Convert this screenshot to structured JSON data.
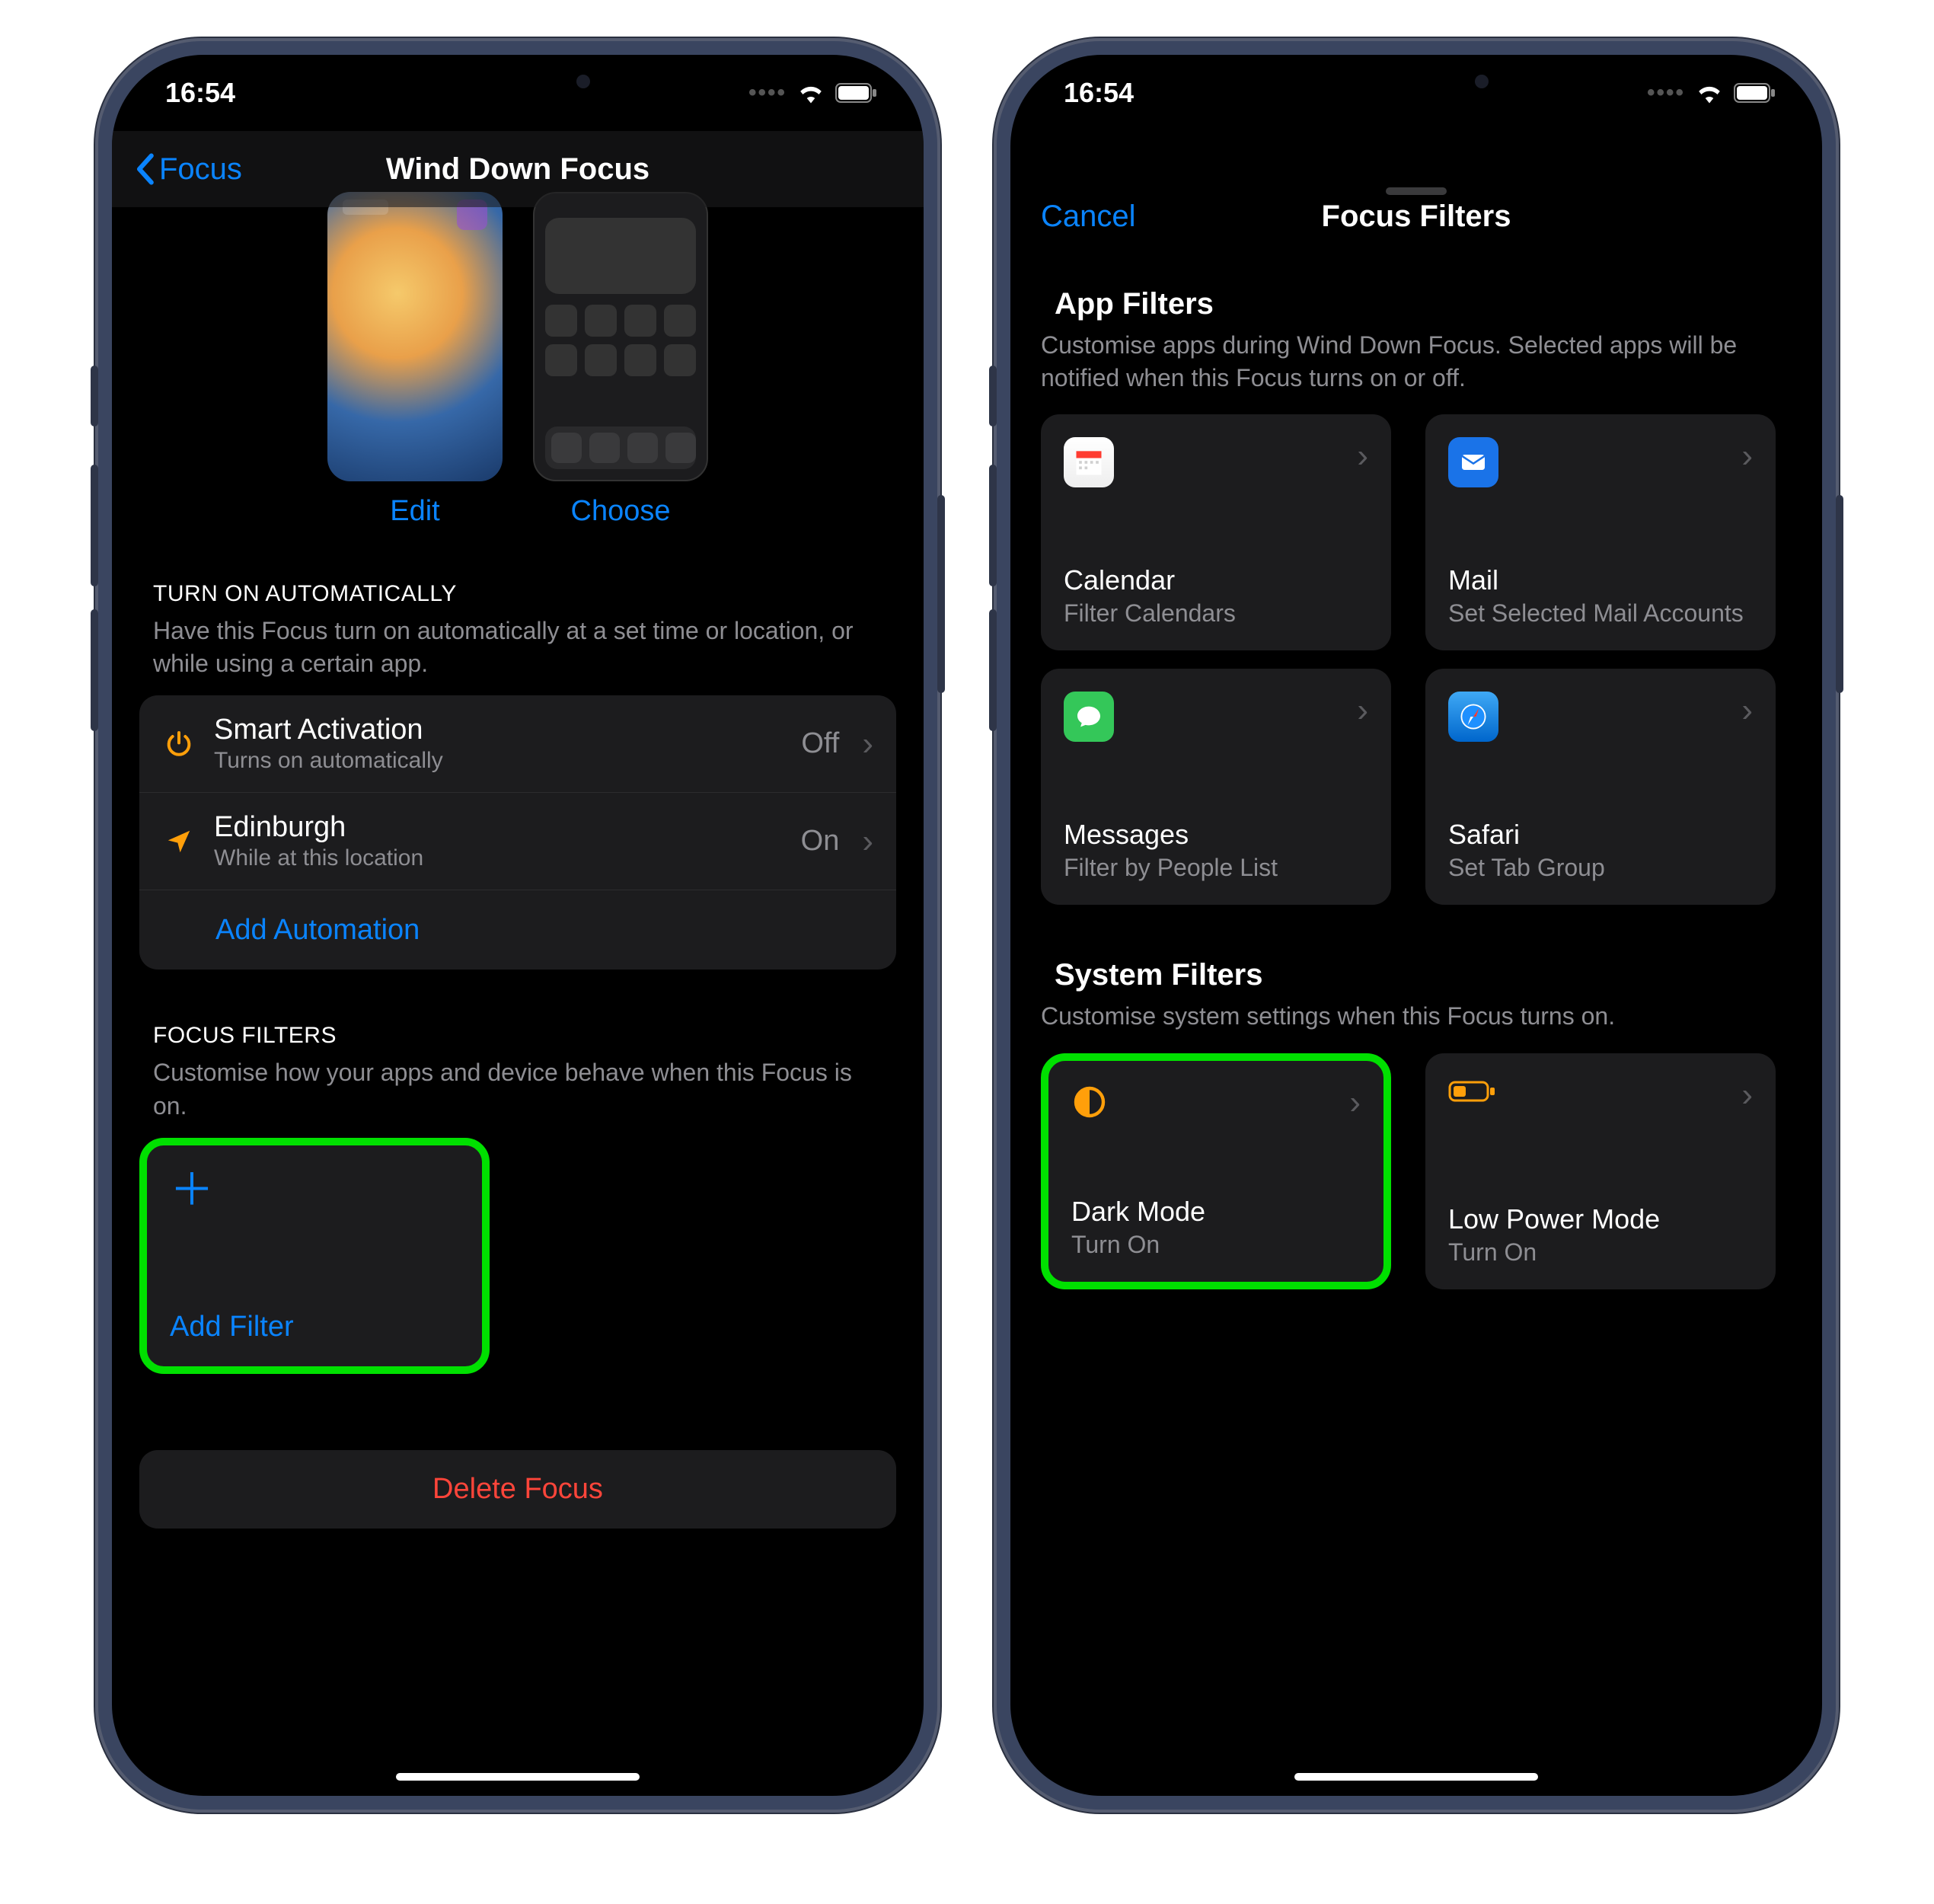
{
  "status": {
    "time": "16:54"
  },
  "left": {
    "nav": {
      "back": "Focus",
      "title": "Wind Down Focus"
    },
    "preview": {
      "edit": "Edit",
      "choose": "Choose"
    },
    "auto": {
      "header": "TURN ON AUTOMATICALLY",
      "sub": "Have this Focus turn on automatically at a set time or location, or while using a certain app.",
      "rows": [
        {
          "title": "Smart Activation",
          "sub": "Turns on automatically",
          "trail": "Off"
        },
        {
          "title": "Edinburgh",
          "sub": "While at this location",
          "trail": "On"
        }
      ],
      "add": "Add Automation"
    },
    "filters": {
      "header": "FOCUS FILTERS",
      "sub": "Customise how your apps and device behave when this Focus is on.",
      "add": "Add Filter"
    },
    "delete": "Delete Focus"
  },
  "right": {
    "sheet": {
      "cancel": "Cancel",
      "title": "Focus Filters"
    },
    "appfilters": {
      "header": "App Filters",
      "sub": "Customise apps during Wind Down Focus. Selected apps will be notified when this Focus turns on or off.",
      "items": [
        {
          "title": "Calendar",
          "sub": "Filter Calendars"
        },
        {
          "title": "Mail",
          "sub": "Set Selected Mail Accounts"
        },
        {
          "title": "Messages",
          "sub": "Filter by People List"
        },
        {
          "title": "Safari",
          "sub": "Set Tab Group"
        }
      ]
    },
    "sysfilters": {
      "header": "System Filters",
      "sub": "Customise system settings when this Focus turns on.",
      "items": [
        {
          "title": "Dark Mode",
          "sub": "Turn On"
        },
        {
          "title": "Low Power Mode",
          "sub": "Turn On"
        }
      ]
    }
  }
}
